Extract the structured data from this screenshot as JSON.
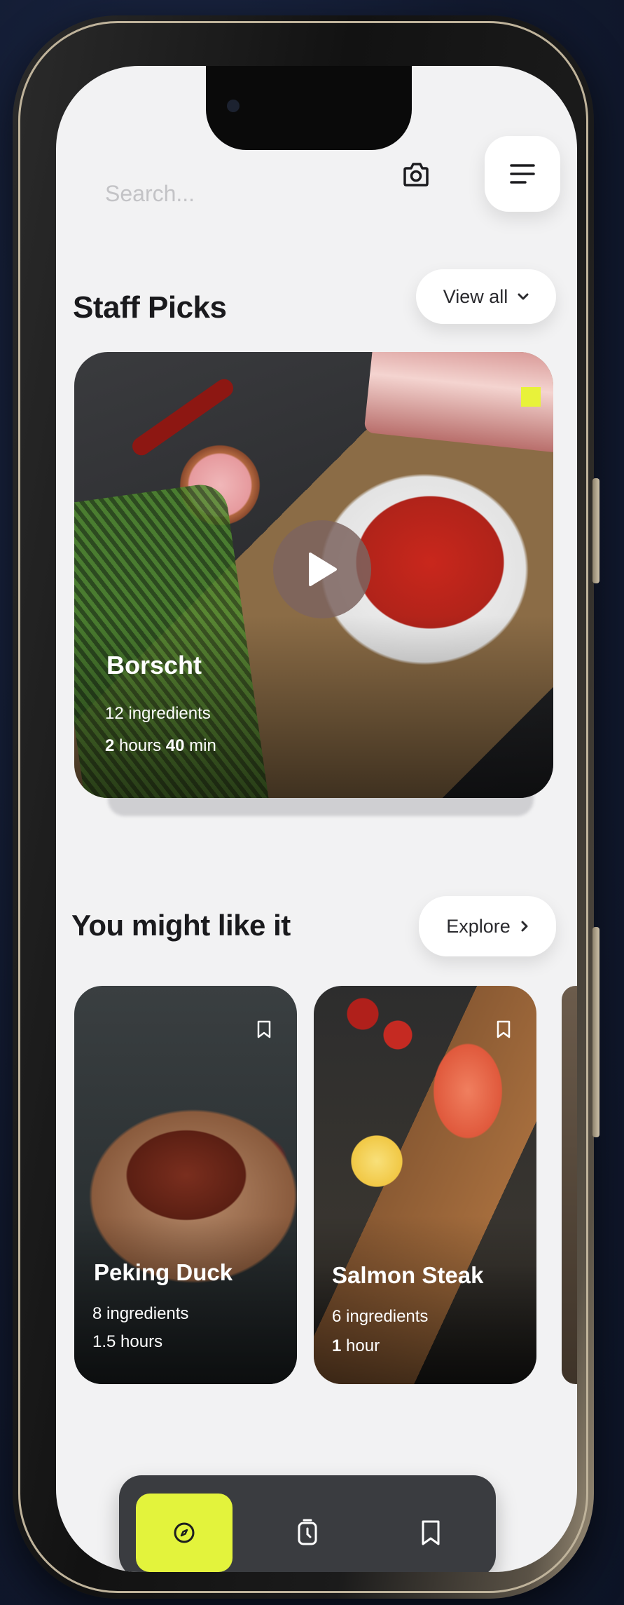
{
  "search": {
    "placeholder": "Search..."
  },
  "header": {
    "camera_icon": "camera-icon",
    "menu_icon": "menu-icon"
  },
  "staff_picks": {
    "title": "Staff Picks",
    "view_all_label": "View all",
    "featured": {
      "name": "Borscht",
      "ingredients": "12 ingredients",
      "time_hours": "2",
      "time_hours_unit": "hours",
      "time_minutes": "40",
      "time_minutes_unit": "min"
    }
  },
  "suggestions": {
    "title": "You might like it",
    "explore_label": "Explore",
    "items": [
      {
        "name": "Peking Duck",
        "ingredients": "8 ingredients",
        "time": "1.5 hours"
      },
      {
        "name": "Salmon Steak",
        "ingredients": "6 ingredients",
        "time_value": "1",
        "time_unit": "hour"
      }
    ]
  },
  "bottom_nav": {
    "items": [
      {
        "icon": "compass-icon",
        "active": true
      },
      {
        "icon": "timer-icon",
        "active": false
      },
      {
        "icon": "bookmark-icon",
        "active": false
      }
    ]
  },
  "colors": {
    "accent": "#e3f33c",
    "nav_bg": "#3a3c40",
    "screen_bg": "#f2f2f3"
  }
}
